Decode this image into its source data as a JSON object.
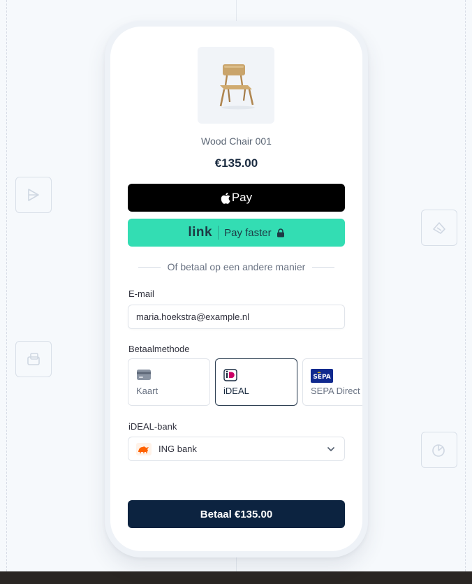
{
  "product": {
    "name": "Wood Chair 001",
    "price": "€135.00",
    "image": "wood-chair-photo"
  },
  "express": {
    "apple_pay_label": "Pay",
    "link_logo": "link",
    "link_label": "Pay faster"
  },
  "divider_text": "Of betaal op een andere manier",
  "email": {
    "label": "E-mail",
    "value": "maria.hoekstra@example.nl"
  },
  "payment_method": {
    "label": "Betaalmethode",
    "options": [
      {
        "label": "Kaart",
        "icon": "card-icon",
        "selected": false
      },
      {
        "label": "iDEAL",
        "icon": "ideal-icon",
        "selected": true
      },
      {
        "label": "SEPA Direct",
        "icon": "sepa-icon",
        "icon_text": "SEPA",
        "selected": false
      }
    ]
  },
  "bank": {
    "label": "iDEAL-bank",
    "value": "ING bank",
    "icon": "ing-lion-icon"
  },
  "pay_button": "Betaal €135.00",
  "colors": {
    "link_green": "#33ddb3",
    "pay_navy": "#0c2340",
    "ideal_pink": "#cc0066",
    "ing_orange": "#ff6200",
    "sepa_blue": "#10298e"
  }
}
